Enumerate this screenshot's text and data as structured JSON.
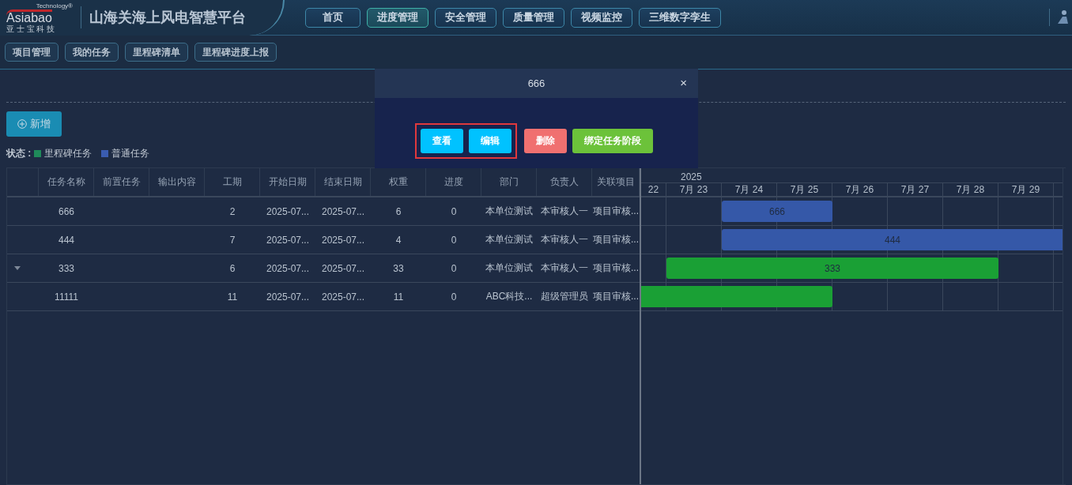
{
  "header": {
    "logo": {
      "tagline": "Technology®",
      "name": "Asiabao",
      "subtitle": "亚 士 宝 科 技"
    },
    "title": "山海关海上风电智慧平台",
    "nav": [
      {
        "label": "首页",
        "selected": false
      },
      {
        "label": "进度管理",
        "selected": true
      },
      {
        "label": "安全管理",
        "selected": false
      },
      {
        "label": "质量管理",
        "selected": false
      },
      {
        "label": "视频监控",
        "selected": false
      },
      {
        "label": "三维数字孪生",
        "selected": false
      }
    ]
  },
  "subnav": [
    {
      "label": "项目管理",
      "selected": false
    },
    {
      "label": "我的任务",
      "selected": false
    },
    {
      "label": "里程碑清单",
      "selected": false
    },
    {
      "label": "里程碑进度上报",
      "selected": false
    }
  ],
  "add_button": {
    "label": "新增"
  },
  "legend": {
    "label": "状态 :",
    "items": [
      {
        "label": "里程碑任务",
        "color": "#1f8a5a"
      },
      {
        "label": "普通任务",
        "color": "#3a5cb0"
      }
    ]
  },
  "table": {
    "columns": [
      "任务名称",
      "前置任务",
      "输出内容",
      "工期",
      "开始日期",
      "结束日期",
      "权重",
      "进度",
      "部门",
      "负责人",
      "关联项目"
    ],
    "rows": [
      {
        "has_children": false,
        "cells": [
          "666",
          "",
          "",
          "2",
          "2025-07...",
          "2025-07...",
          "6",
          "0",
          "本单位测试",
          "本审核人一",
          "项目审核..."
        ]
      },
      {
        "has_children": false,
        "cells": [
          "444",
          "",
          "",
          "7",
          "2025-07...",
          "2025-07...",
          "4",
          "0",
          "本单位测试",
          "本审核人一",
          "项目审核..."
        ]
      },
      {
        "has_children": true,
        "cells": [
          "333",
          "",
          "",
          "6",
          "2025-07...",
          "2025-07...",
          "33",
          "0",
          "本单位测试",
          "本审核人一",
          "项目审核..."
        ]
      },
      {
        "has_children": false,
        "cells": [
          "11111",
          "",
          "",
          "11",
          "2025-07...",
          "2025-07...",
          "11",
          "0",
          "ABC科技...",
          "超级管理员",
          "项目审核..."
        ]
      }
    ]
  },
  "gantt": {
    "year": "2025",
    "days": [
      "22",
      "7月 23",
      "7月 24",
      "7月 25",
      "7月 26",
      "7月 27",
      "7月 28",
      "7月 29"
    ],
    "bars": [
      {
        "label": "666",
        "color": "#3558a8"
      },
      {
        "label": "444",
        "color": "#3558a8"
      },
      {
        "label": "333",
        "color": "#1aa035"
      },
      {
        "color": "#1aa035"
      }
    ]
  },
  "modal": {
    "title": "666",
    "close": "×",
    "action_groups": [
      {
        "highlighted": true,
        "actions": [
          {
            "label": "查看",
            "kind": "info"
          },
          {
            "label": "编辑",
            "kind": "info"
          }
        ]
      },
      {
        "highlighted": false,
        "actions": [
          {
            "label": "删除",
            "kind": "danger"
          },
          {
            "label": "绑定任务阶段",
            "kind": "success"
          }
        ]
      }
    ]
  }
}
